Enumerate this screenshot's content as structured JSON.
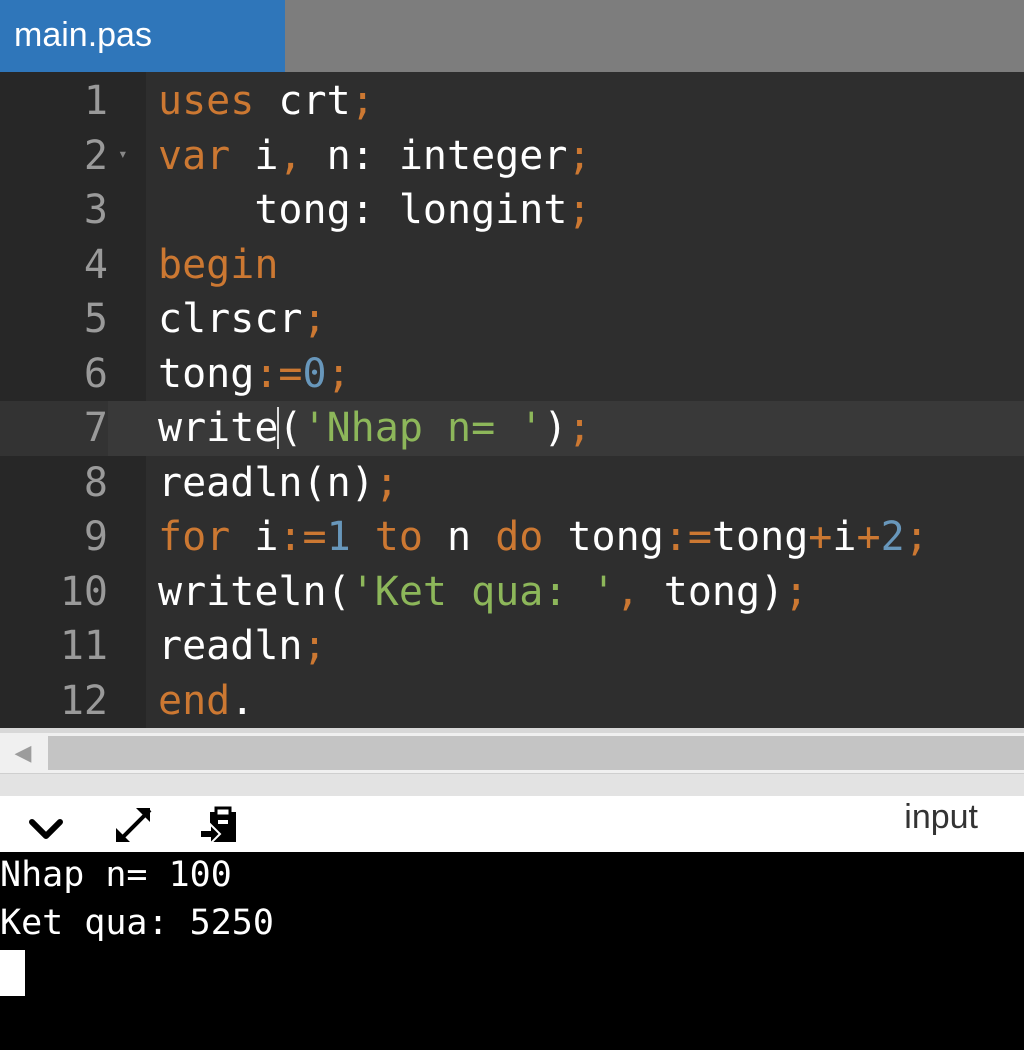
{
  "tab": {
    "filename": "main.pas"
  },
  "editor": {
    "active_line": 7,
    "lines": [
      {
        "num": "1",
        "tokens": [
          {
            "t": "uses",
            "c": "kw"
          },
          {
            "t": " crt",
            "c": "pl"
          },
          {
            "t": ";",
            "c": "pu"
          }
        ]
      },
      {
        "num": "2",
        "fold": true,
        "tokens": [
          {
            "t": "var",
            "c": "kw"
          },
          {
            "t": " i",
            "c": "pl"
          },
          {
            "t": ",",
            "c": "pu"
          },
          {
            "t": " n: integer",
            "c": "pl"
          },
          {
            "t": ";",
            "c": "pu"
          }
        ]
      },
      {
        "num": "3",
        "tokens": [
          {
            "t": "    tong: longint",
            "c": "pl"
          },
          {
            "t": ";",
            "c": "pu"
          }
        ]
      },
      {
        "num": "4",
        "tokens": [
          {
            "t": "begin",
            "c": "kw"
          }
        ]
      },
      {
        "num": "5",
        "tokens": [
          {
            "t": "clrscr",
            "c": "pl"
          },
          {
            "t": ";",
            "c": "pu"
          }
        ]
      },
      {
        "num": "6",
        "tokens": [
          {
            "t": "tong",
            "c": "pl"
          },
          {
            "t": ":=",
            "c": "pu"
          },
          {
            "t": "0",
            "c": "num"
          },
          {
            "t": ";",
            "c": "pu"
          }
        ]
      },
      {
        "num": "7",
        "tokens": [
          {
            "t": "write",
            "c": "pl"
          },
          {
            "t": "",
            "c": "cursor"
          },
          {
            "t": "(",
            "c": "pl"
          },
          {
            "t": "'Nhap n= '",
            "c": "str"
          },
          {
            "t": ")",
            "c": "pl"
          },
          {
            "t": ";",
            "c": "pu"
          }
        ]
      },
      {
        "num": "8",
        "tokens": [
          {
            "t": "readln(n)",
            "c": "pl"
          },
          {
            "t": ";",
            "c": "pu"
          }
        ]
      },
      {
        "num": "9",
        "tokens": [
          {
            "t": "for",
            "c": "kw"
          },
          {
            "t": " i",
            "c": "pl"
          },
          {
            "t": ":=",
            "c": "pu"
          },
          {
            "t": "1",
            "c": "num"
          },
          {
            "t": " to",
            "c": "kw"
          },
          {
            "t": " n",
            "c": "pl"
          },
          {
            "t": " do",
            "c": "kw"
          },
          {
            "t": " tong",
            "c": "pl"
          },
          {
            "t": ":=",
            "c": "pu"
          },
          {
            "t": "tong",
            "c": "pl"
          },
          {
            "t": "+",
            "c": "pu"
          },
          {
            "t": "i",
            "c": "pl"
          },
          {
            "t": "+",
            "c": "pu"
          },
          {
            "t": "2",
            "c": "num"
          },
          {
            "t": ";",
            "c": "pu"
          }
        ]
      },
      {
        "num": "10",
        "tokens": [
          {
            "t": "writeln(",
            "c": "pl"
          },
          {
            "t": "'Ket qua: '",
            "c": "str"
          },
          {
            "t": ",",
            "c": "pu"
          },
          {
            "t": " tong)",
            "c": "pl"
          },
          {
            "t": ";",
            "c": "pu"
          }
        ]
      },
      {
        "num": "11",
        "tokens": [
          {
            "t": "readln",
            "c": "pl"
          },
          {
            "t": ";",
            "c": "pu"
          }
        ]
      },
      {
        "num": "12",
        "tokens": [
          {
            "t": "end",
            "c": "kw"
          },
          {
            "t": ".",
            "c": "pl"
          }
        ]
      }
    ]
  },
  "console_toolbar": {
    "icons": [
      "chevron-down-icon",
      "expand-icon",
      "paste-icon"
    ],
    "input_label": "input"
  },
  "console": {
    "lines": [
      "Nhap n= 100",
      "Ket qua: 5250"
    ]
  },
  "colors": {
    "tab_active": "#2f76ba",
    "editor_bg": "#2e2e2e",
    "keyword": "#cc7832",
    "number": "#6897bb",
    "string": "#8db75a"
  }
}
